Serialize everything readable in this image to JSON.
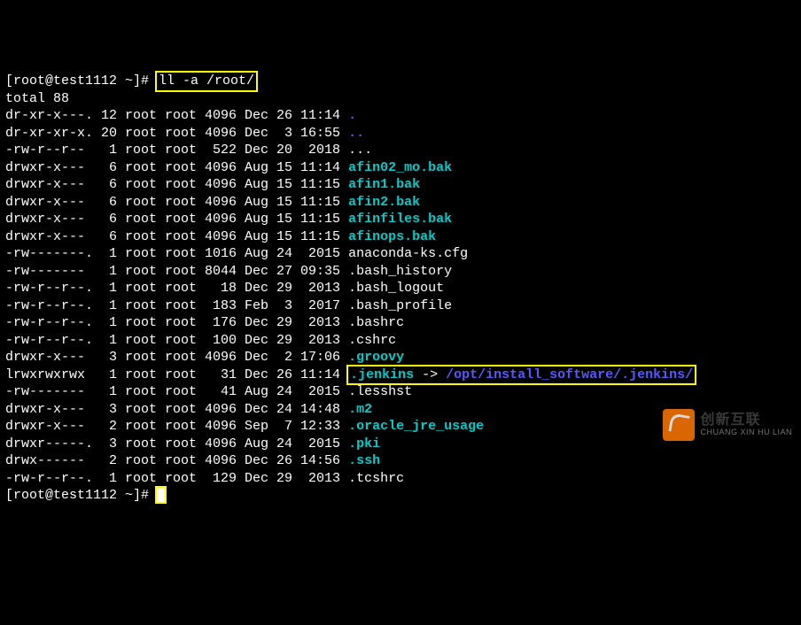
{
  "prompt1": "[root@test1112 ~]# ",
  "command": "ll -a /root/",
  "total": "total 88",
  "rows": [
    {
      "perm": "dr-xr-x---.",
      "links": "12",
      "owner": "root",
      "group": "root",
      "size": "4096",
      "month": "Dec",
      "day": "26",
      "time": "11:14",
      "name": ".",
      "cls": "dir-dot"
    },
    {
      "perm": "dr-xr-xr-x.",
      "links": "20",
      "owner": "root",
      "group": "root",
      "size": "4096",
      "month": "Dec",
      "day": " 3",
      "time": "16:55",
      "name": "..",
      "cls": "dir-dot"
    },
    {
      "perm": "-rw-r--r--",
      "links": " 1",
      "owner": "root",
      "group": "root",
      "size": " 522",
      "month": "Dec",
      "day": "20",
      "time": " 2018",
      "name": "...",
      "cls": ""
    },
    {
      "perm": "drwxr-x---",
      "links": " 6",
      "owner": "root",
      "group": "root",
      "size": "4096",
      "month": "Aug",
      "day": "15",
      "time": "11:14",
      "name": "afin02_mo.bak",
      "cls": "cyan-file"
    },
    {
      "perm": "drwxr-x---",
      "links": " 6",
      "owner": "root",
      "group": "root",
      "size": "4096",
      "month": "Aug",
      "day": "15",
      "time": "11:15",
      "name": "afin1.bak",
      "cls": "cyan-file"
    },
    {
      "perm": "drwxr-x---",
      "links": " 6",
      "owner": "root",
      "group": "root",
      "size": "4096",
      "month": "Aug",
      "day": "15",
      "time": "11:15",
      "name": "afin2.bak",
      "cls": "cyan-file"
    },
    {
      "perm": "drwxr-x---",
      "links": " 6",
      "owner": "root",
      "group": "root",
      "size": "4096",
      "month": "Aug",
      "day": "15",
      "time": "11:15",
      "name": "afinfiles.bak",
      "cls": "cyan-file"
    },
    {
      "perm": "drwxr-x---",
      "links": " 6",
      "owner": "root",
      "group": "root",
      "size": "4096",
      "month": "Aug",
      "day": "15",
      "time": "11:15",
      "name": "afinops.bak",
      "cls": "cyan-file"
    },
    {
      "perm": "-rw-------.",
      "links": " 1",
      "owner": "root",
      "group": "root",
      "size": "1016",
      "month": "Aug",
      "day": "24",
      "time": " 2015",
      "name": "anaconda-ks.cfg",
      "cls": ""
    },
    {
      "perm": "-rw-------",
      "links": " 1",
      "owner": "root",
      "group": "root",
      "size": "8044",
      "month": "Dec",
      "day": "27",
      "time": "09:35",
      "name": ".bash_history",
      "cls": ""
    },
    {
      "perm": "-rw-r--r--.",
      "links": " 1",
      "owner": "root",
      "group": "root",
      "size": "  18",
      "month": "Dec",
      "day": "29",
      "time": " 2013",
      "name": ".bash_logout",
      "cls": ""
    },
    {
      "perm": "-rw-r--r--.",
      "links": " 1",
      "owner": "root",
      "group": "root",
      "size": " 183",
      "month": "Feb",
      "day": " 3",
      "time": " 2017",
      "name": ".bash_profile",
      "cls": ""
    },
    {
      "perm": "-rw-r--r--.",
      "links": " 1",
      "owner": "root",
      "group": "root",
      "size": " 176",
      "month": "Dec",
      "day": "29",
      "time": " 2013",
      "name": ".bashrc",
      "cls": ""
    },
    {
      "perm": "-rw-r--r--.",
      "links": " 1",
      "owner": "root",
      "group": "root",
      "size": " 100",
      "month": "Dec",
      "day": "29",
      "time": " 2013",
      "name": ".cshrc",
      "cls": ""
    },
    {
      "perm": "drwxr-x---",
      "links": " 3",
      "owner": "root",
      "group": "root",
      "size": "4096",
      "month": "Dec",
      "day": " 2",
      "time": "17:06",
      "name": ".groovy",
      "cls": "cyan-file"
    },
    {
      "perm": "lrwxrwxrwx",
      "links": " 1",
      "owner": "root",
      "group": "root",
      "size": "  31",
      "month": "Dec",
      "day": "26",
      "time": "11:14",
      "name": ".jenkins",
      "target": "/opt/install_software/.jenkins/",
      "cls": "symlink",
      "boxed": true
    },
    {
      "perm": "-rw-------",
      "links": " 1",
      "owner": "root",
      "group": "root",
      "size": "  41",
      "month": "Aug",
      "day": "24",
      "time": " 2015",
      "name": ".lesshst",
      "cls": ""
    },
    {
      "perm": "drwxr-x---",
      "links": " 3",
      "owner": "root",
      "group": "root",
      "size": "4096",
      "month": "Dec",
      "day": "24",
      "time": "14:48",
      "name": ".m2",
      "cls": "cyan-file"
    },
    {
      "perm": "drwxr-x---",
      "links": " 2",
      "owner": "root",
      "group": "root",
      "size": "4096",
      "month": "Sep",
      "day": " 7",
      "time": "12:33",
      "name": ".oracle_jre_usage",
      "cls": "cyan-file"
    },
    {
      "perm": "drwxr-----.",
      "links": " 3",
      "owner": "root",
      "group": "root",
      "size": "4096",
      "month": "Aug",
      "day": "24",
      "time": " 2015",
      "name": ".pki",
      "cls": "cyan-file"
    },
    {
      "perm": "drwx------",
      "links": " 2",
      "owner": "root",
      "group": "root",
      "size": "4096",
      "month": "Dec",
      "day": "26",
      "time": "14:56",
      "name": ".ssh",
      "cls": "cyan-file"
    },
    {
      "perm": "-rw-r--r--.",
      "links": " 1",
      "owner": "root",
      "group": "root",
      "size": " 129",
      "month": "Dec",
      "day": "29",
      "time": " 2013",
      "name": ".tcshrc",
      "cls": ""
    }
  ],
  "prompt2": "[root@test1112 ~]# ",
  "arrow": " -> ",
  "watermark": {
    "cn": "创新互联",
    "en": "CHUANG XIN HU LIAN"
  }
}
